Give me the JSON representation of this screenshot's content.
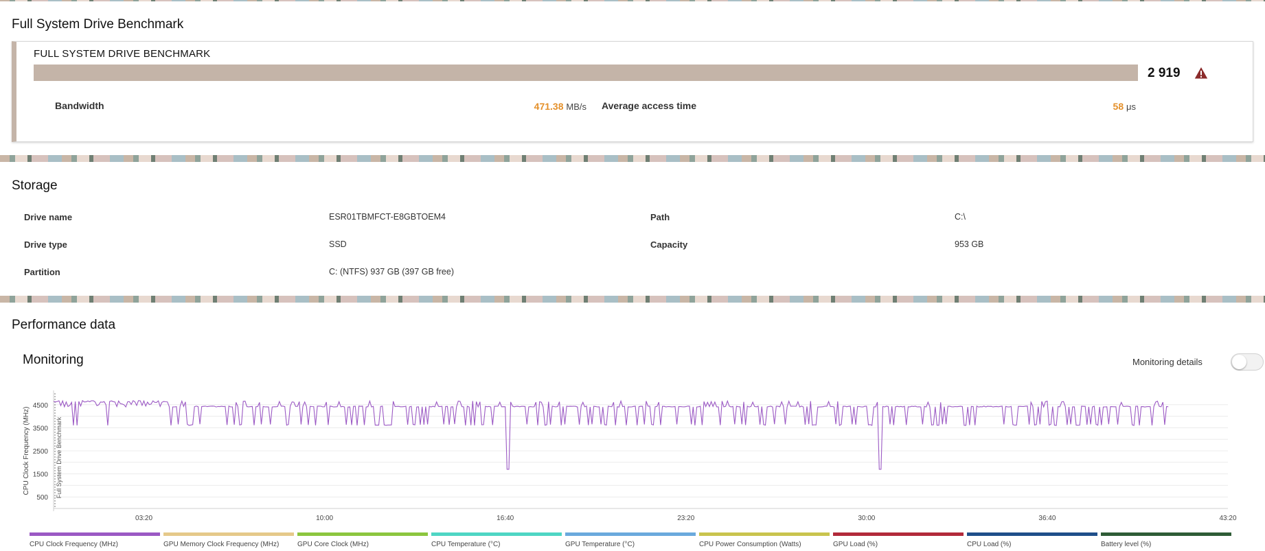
{
  "benchmark": {
    "section_title": "Full System Drive Benchmark",
    "panel_title": "FULL SYSTEM DRIVE BENCHMARK",
    "score": "2 919",
    "bar_color": "#c4b4a8",
    "warning_icon": "warning-triangle-icon",
    "warning_color": "#8b2b2b",
    "bandwidth": {
      "label": "Bandwidth",
      "value": "471.38",
      "unit": "MB/s"
    },
    "access_time": {
      "label": "Average access time",
      "value": "58",
      "unit": "μs"
    },
    "accent_color": "#e4902a"
  },
  "storage": {
    "section_title": "Storage",
    "drive_name": {
      "label": "Drive name",
      "value": "ESR01TBMFCT-E8GBTOEM4"
    },
    "drive_type": {
      "label": "Drive type",
      "value": "SSD"
    },
    "partition": {
      "label": "Partition",
      "value": "C: (NTFS) 937 GB (397 GB free)"
    },
    "path": {
      "label": "Path",
      "value": "C:\\"
    },
    "capacity": {
      "label": "Capacity",
      "value": "953 GB"
    }
  },
  "performance": {
    "section_title": "Performance data",
    "monitoring_title": "Monitoring",
    "monitoring_details_label": "Monitoring details",
    "monitoring_details_enabled": false,
    "legend": [
      {
        "label": "CPU Clock Frequency (MHz)",
        "color": "#9b59c4"
      },
      {
        "label": "GPU Memory Clock Frequency (MHz)",
        "color": "#e5c98a"
      },
      {
        "label": "GPU Core Clock (MHz)",
        "color": "#8cc63f"
      },
      {
        "label": "CPU Temperature (°C)",
        "color": "#4fd6c4"
      },
      {
        "label": "GPU Temperature (°C)",
        "color": "#6aa9dd"
      },
      {
        "label": "CPU Power Consumption (Watts)",
        "color": "#c9c44e"
      },
      {
        "label": "GPU Load (%)",
        "color": "#b22a3a"
      },
      {
        "label": "CPU Load (%)",
        "color": "#1f4f8a"
      },
      {
        "label": "Battery level (%)",
        "color": "#2e5c36"
      }
    ]
  },
  "chart_data": {
    "type": "line",
    "ylabel": "CPU Clock Frequency (MHz)",
    "marker_label": "Full System Drive Benchmark",
    "y_ticks": [
      500,
      1500,
      2500,
      3500,
      4500
    ],
    "ylim": [
      0,
      5000
    ],
    "x_ticks": [
      "03:20",
      "10:00",
      "16:40",
      "23:20",
      "30:00",
      "36:40",
      "43:20"
    ],
    "xlim_seconds": [
      0,
      2600
    ],
    "grid": true,
    "series": [
      {
        "name": "CPU Clock Frequency (MHz)",
        "color": "#9b59c4",
        "base_mhz": 4400,
        "high_mhz": 4600,
        "low_mhz": 3600,
        "dips": [
          {
            "t": 1005,
            "v": 1700
          },
          {
            "t": 1830,
            "v": 1700
          }
        ],
        "end_seconds": 2470
      }
    ]
  }
}
